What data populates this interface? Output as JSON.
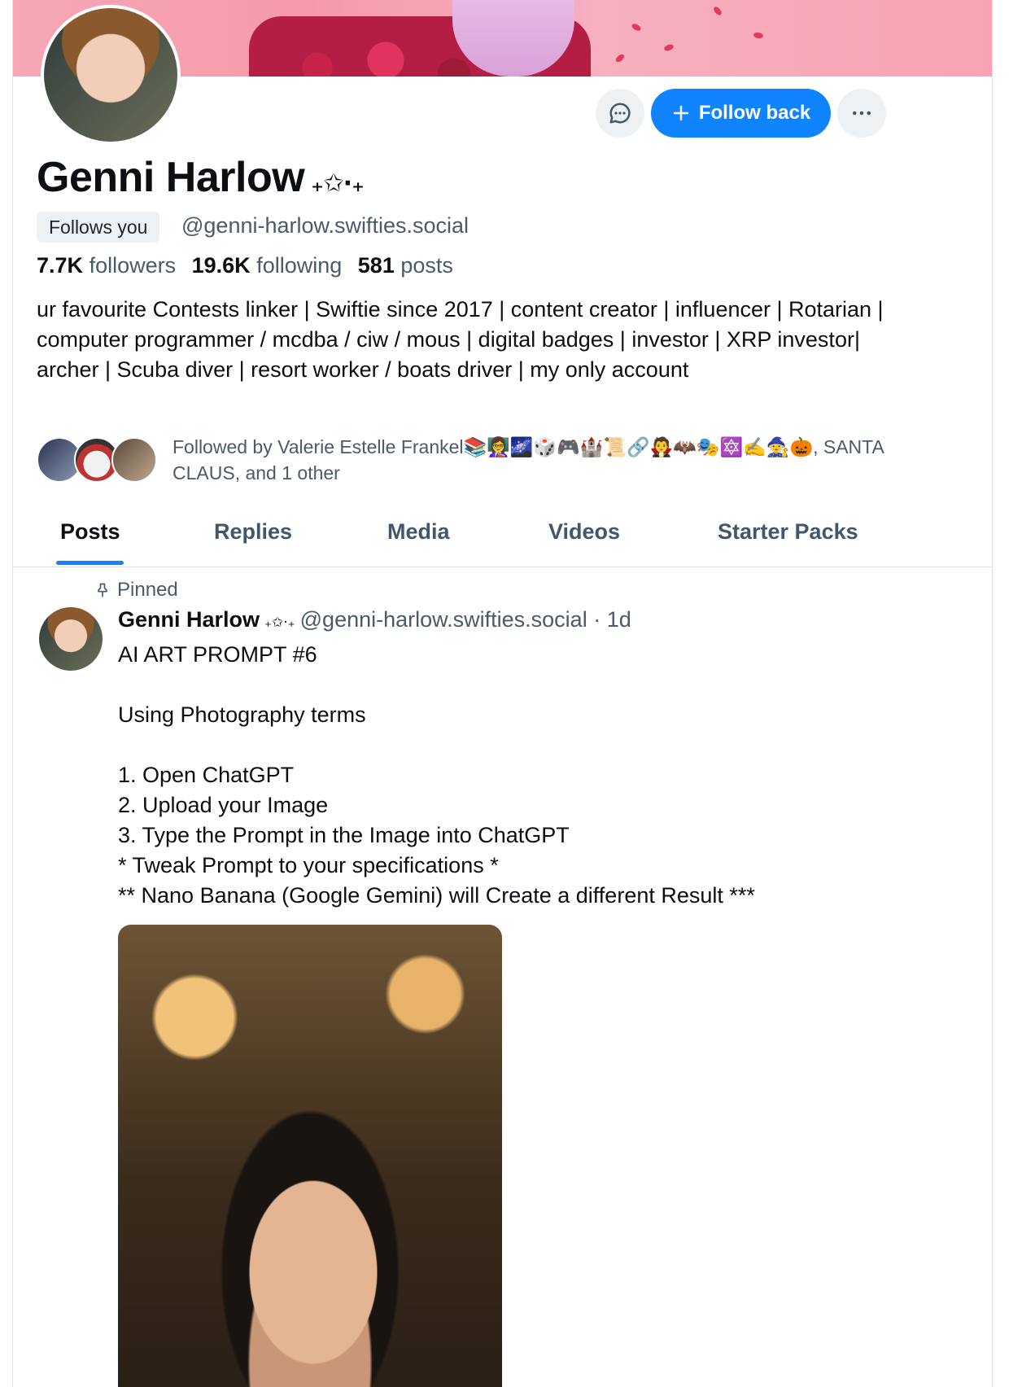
{
  "profile": {
    "display_name": "Genni Harlow",
    "name_decoration": "₊✩‧₊",
    "follows_you_label": "Follows you",
    "handle": "@genni-harlow.swifties.social",
    "stats": {
      "followers_count": "7.7K",
      "followers_label": "followers",
      "following_count": "19.6K",
      "following_label": "following",
      "posts_count": "581",
      "posts_label": "posts"
    },
    "bio": "ur favourite Contests linker | Swiftie since 2017 | content creator | influencer | Rotarian | computer programmer / mcdba / ciw / mous | digital badges | investor | XRP investor| archer | Scuba diver | resort worker / boats driver | my only account",
    "followed_by": "Followed by Valerie Estelle Frankel📚👩‍🏫🌌🎲🎮🏰📜🔗🧛🦇🎭🔯✍️🧙🎃, SANTA CLAUS, and 1 other"
  },
  "actions": {
    "follow_back_label": "Follow back"
  },
  "tabs": [
    {
      "label": "Posts"
    },
    {
      "label": "Replies"
    },
    {
      "label": "Media"
    },
    {
      "label": "Videos"
    },
    {
      "label": "Starter Packs"
    }
  ],
  "pinned_post": {
    "pinned_label": "Pinned",
    "author_name": "Genni Harlow",
    "author_decoration": "₊✩‧₊",
    "author_handle": "@genni-harlow.swifties.social",
    "time": "· 1d",
    "text": "AI ART PROMPT #6\n\nUsing Photography terms\n\n1. Open ChatGPT\n2. Upload your Image\n3. Type the Prompt in the Image into ChatGPT\n* Tweak Prompt to your specifications *\n** Nano Banana (Google Gemini) will Create a different Result ***"
  },
  "colors": {
    "accent": "#1083fe",
    "muted_text": "#4b5968",
    "pill_bg": "#eef1f4"
  }
}
